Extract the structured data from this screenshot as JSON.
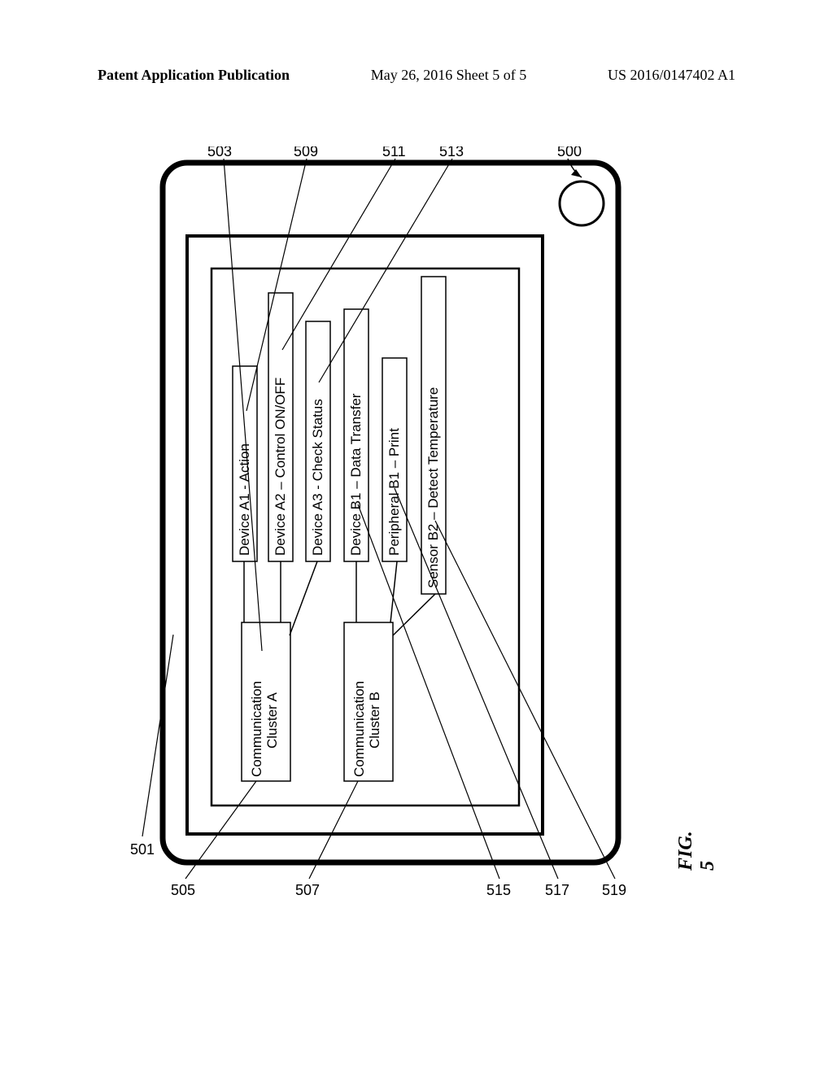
{
  "header": {
    "left": "Patent Application Publication",
    "center": "May 26, 2016  Sheet 5 of 5",
    "right": "US 2016/0147402 A1"
  },
  "figure": {
    "caption": "FIG. 5",
    "labels": {
      "ref_500": "500",
      "ref_501": "501",
      "ref_503": "503",
      "ref_505": "505",
      "ref_507": "507",
      "ref_509": "509",
      "ref_511": "511",
      "ref_513": "513",
      "ref_515": "515",
      "ref_517": "517",
      "ref_519": "519"
    },
    "boxes": {
      "cluster_a": "Communication\nCluster A",
      "cluster_b": "Communication\nCluster B",
      "device_a1": "Device A1 - Action",
      "device_a2": "Device A2 – Control ON/OFF",
      "device_a3": "Device A3 - Check Status",
      "device_b1": "Device B1 – Data Transfer",
      "peripheral_b1": "Peripheral B1 – Print",
      "sensor_b2": "Sensor B2 – Detect Temperature"
    }
  }
}
